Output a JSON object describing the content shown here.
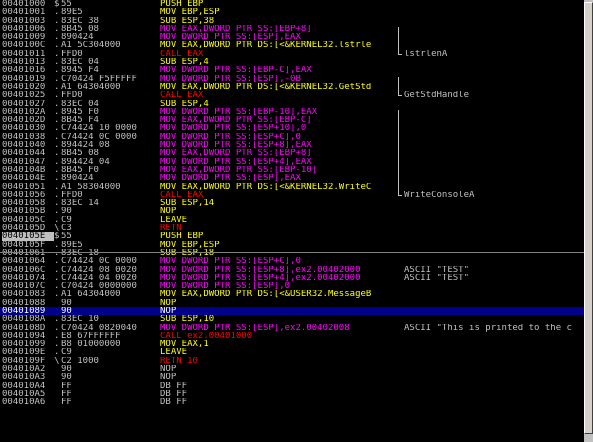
{
  "rows": [
    {
      "addr": "00401000",
      "mark": "$",
      "hex": "55",
      "dis": "PUSH EBP",
      "cls": "t-yellow",
      "cmt": ""
    },
    {
      "addr": "00401001",
      "mark": ".",
      "hex": "89E5",
      "dis": "MOV EBP,ESP",
      "cls": "t-yellow",
      "cmt": ""
    },
    {
      "addr": "00401003",
      "mark": ".",
      "hex": "83EC 38",
      "dis": "SUB ESP,38",
      "cls": "t-yellow",
      "cmt": ""
    },
    {
      "addr": "00401006",
      "mark": ".",
      "hex": "8B45 08",
      "dis": "MOV EAX,DWORD PTR SS:[EBP+8]",
      "cls": "t-purple",
      "cmt": ""
    },
    {
      "addr": "00401009",
      "mark": ".",
      "hex": "890424",
      "dis": "MOV DWORD PTR SS:[ESP],EAX",
      "cls": "t-purple",
      "cmt": ""
    },
    {
      "addr": "0040100C",
      "mark": ".",
      "hex": "A1 5C304000",
      "dis": "MOV EAX,DWORD PTR DS:[<&KERNEL32.lstrle",
      "cls": "t-yellow",
      "cmt": ""
    },
    {
      "addr": "00401011",
      "mark": ".",
      "hex": "FFD0",
      "dis": "CALL EAX",
      "cls": "t-red",
      "cmt": "lstrlenA"
    },
    {
      "addr": "00401013",
      "mark": ".",
      "hex": "83EC 04",
      "dis": "SUB ESP,4",
      "cls": "t-yellow",
      "cmt": ""
    },
    {
      "addr": "00401016",
      "mark": ".",
      "hex": "8945 F4",
      "dis": "MOV DWORD PTR SS:[EBP-C],EAX",
      "cls": "t-purple",
      "cmt": ""
    },
    {
      "addr": "00401019",
      "mark": ".",
      "hex": "C70424 F5FFFFF",
      "dis": "MOV DWORD PTR SS:[ESP],-0B",
      "cls": "t-purple",
      "cmt": ""
    },
    {
      "addr": "00401020",
      "mark": ".",
      "hex": "A1 64304000",
      "dis": "MOV EAX,DWORD PTR DS:[<&KERNEL32.GetStd",
      "cls": "t-yellow",
      "cmt": ""
    },
    {
      "addr": "00401025",
      "mark": ".",
      "hex": "FFD0",
      "dis": "CALL EAX",
      "cls": "t-red",
      "cmt": "GetStdHandle"
    },
    {
      "addr": "00401027",
      "mark": ".",
      "hex": "83EC 04",
      "dis": "SUB ESP,4",
      "cls": "t-yellow",
      "cmt": ""
    },
    {
      "addr": "0040102A",
      "mark": ".",
      "hex": "8945 F0",
      "dis": "MOV DWORD PTR SS:[EBP-10],EAX",
      "cls": "t-purple",
      "cmt": ""
    },
    {
      "addr": "0040102D",
      "mark": ".",
      "hex": "8B45 F4",
      "dis": "MOV EAX,DWORD PTR SS:[EBP-C]",
      "cls": "t-purple",
      "cmt": ""
    },
    {
      "addr": "00401030",
      "mark": ".",
      "hex": "C74424 10 0000",
      "dis": "MOV DWORD PTR SS:[ESP+10],0",
      "cls": "t-purple",
      "cmt": ""
    },
    {
      "addr": "00401038",
      "mark": ".",
      "hex": "C74424 0C 0000",
      "dis": "MOV DWORD PTR SS:[ESP+C],0",
      "cls": "t-purple",
      "cmt": ""
    },
    {
      "addr": "00401040",
      "mark": ".",
      "hex": "894424 08",
      "dis": "MOV DWORD PTR SS:[ESP+8],EAX",
      "cls": "t-purple",
      "cmt": ""
    },
    {
      "addr": "00401044",
      "mark": ".",
      "hex": "8B45 08",
      "dis": "MOV EAX,DWORD PTR SS:[EBP+8]",
      "cls": "t-purple",
      "cmt": ""
    },
    {
      "addr": "00401047",
      "mark": ".",
      "hex": "894424 04",
      "dis": "MOV DWORD PTR SS:[ESP+4],EAX",
      "cls": "t-purple",
      "cmt": ""
    },
    {
      "addr": "0040104B",
      "mark": ".",
      "hex": "8B45 F0",
      "dis": "MOV EAX,DWORD PTR SS:[EBP-10]",
      "cls": "t-purple",
      "cmt": ""
    },
    {
      "addr": "0040104E",
      "mark": ".",
      "hex": "890424",
      "dis": "MOV DWORD PTR SS:[ESP],EAX",
      "cls": "t-purple",
      "cmt": ""
    },
    {
      "addr": "00401051",
      "mark": ".",
      "hex": "A1 58304000",
      "dis": "MOV EAX,DWORD PTR DS:[<&KERNEL32.WriteC",
      "cls": "t-yellow",
      "cmt": ""
    },
    {
      "addr": "00401056",
      "mark": ".",
      "hex": "FFD0",
      "dis": "CALL EAX",
      "cls": "t-red",
      "cmt": "WriteConsoleA"
    },
    {
      "addr": "00401058",
      "mark": ".",
      "hex": "83EC 14",
      "dis": "SUB ESP,14",
      "cls": "t-yellow",
      "cmt": ""
    },
    {
      "addr": "0040105B",
      "mark": ".",
      "hex": "90",
      "dis": "NOP",
      "cls": "t-yellow",
      "cmt": ""
    },
    {
      "addr": "0040105C",
      "mark": ".",
      "hex": "C9",
      "dis": "LEAVE",
      "cls": "t-yellow",
      "cmt": ""
    },
    {
      "addr": "0040105D",
      "mark": "\\",
      "hex": "C3",
      "dis": "RETN",
      "cls": "t-red",
      "cmt": ""
    },
    {
      "addr": "0040105E",
      "mark": "$",
      "hex": "55",
      "dis": "PUSH EBP",
      "cls": "t-yellow",
      "cmt": "",
      "addrsel": true
    },
    {
      "addr": "0040105F",
      "mark": ".",
      "hex": "89E5",
      "dis": "MOV EBP,ESP",
      "cls": "t-yellow",
      "cmt": ""
    },
    {
      "addr": "00401061",
      "mark": ".",
      "hex": "83EC 18",
      "dis": "SUB ESP,18",
      "cls": "t-yellow",
      "cmt": ""
    },
    {
      "addr": "00401064",
      "mark": ".",
      "hex": "C74424 0C 0000",
      "dis": "MOV DWORD PTR SS:[ESP+C],0",
      "cls": "t-purple",
      "cmt": ""
    },
    {
      "addr": "0040106C",
      "mark": ".",
      "hex": "C74424 08 0020",
      "dis": "MOV DWORD PTR SS:[ESP+8],ex2.00402000",
      "cls": "t-purple",
      "cmt": "ASCII \"TEST\""
    },
    {
      "addr": "00401074",
      "mark": ".",
      "hex": "C74424 04 0020",
      "dis": "MOV DWORD PTR SS:[ESP+4],ex2.00402000",
      "cls": "t-purple",
      "cmt": "ASCII \"TEST\""
    },
    {
      "addr": "0040107C",
      "mark": ".",
      "hex": "C70424 0000000",
      "dis": "MOV DWORD PTR SS:[ESP],0",
      "cls": "t-purple",
      "cmt": ""
    },
    {
      "addr": "00401083",
      "mark": ".",
      "hex": "A1 64304000",
      "dis": "MOV EAX,DWORD PTR DS:[<&USER32.MessageB",
      "cls": "t-yellow",
      "cmt": ""
    },
    {
      "addr": "00401088",
      "mark": " ",
      "hex": "90",
      "dis": "NOP",
      "cls": "t-yellow",
      "cmt": ""
    },
    {
      "addr": "00401089",
      "mark": " ",
      "hex": "90",
      "dis": "NOP",
      "cls": "t-yellow",
      "cmt": "",
      "sel": true
    },
    {
      "addr": "0040108A",
      "mark": ".",
      "hex": "83EC 10",
      "dis": "SUB ESP,10",
      "cls": "t-yellow",
      "cmt": ""
    },
    {
      "addr": "0040108D",
      "mark": ".",
      "hex": "C70424 0820040",
      "dis": "MOV DWORD PTR SS:[ESP],ex2.00402008",
      "cls": "t-purple",
      "cmt": "ASCII \"This is printed to the c"
    },
    {
      "addr": "00401094",
      "mark": ".",
      "hex": "E8 67FFFFFF",
      "dis": "CALL ex2.00401000",
      "cls": "t-red",
      "cmt": ""
    },
    {
      "addr": "00401099",
      "mark": ".",
      "hex": "B8 01000000",
      "dis": "MOV EAX,1",
      "cls": "t-yellow",
      "cmt": ""
    },
    {
      "addr": "0040109E",
      "mark": ".",
      "hex": "C9",
      "dis": "LEAVE",
      "cls": "t-yellow",
      "cmt": ""
    },
    {
      "addr": "0040109F",
      "mark": "\\",
      "hex": "C2 1000",
      "dis": "RETN 10",
      "cls": "t-red",
      "cmt": ""
    },
    {
      "addr": "004010A2",
      "mark": " ",
      "hex": "90",
      "dis": "NOP",
      "cls": "t-norm",
      "cmt": ""
    },
    {
      "addr": "004010A3",
      "mark": " ",
      "hex": "90",
      "dis": "NOP",
      "cls": "t-norm",
      "cmt": ""
    },
    {
      "addr": "004010A4",
      "mark": " ",
      "hex": "FF",
      "dis": "DB FF",
      "cls": "t-norm",
      "cmt": ""
    },
    {
      "addr": "004010A5",
      "mark": " ",
      "hex": "FF",
      "dis": "DB FF",
      "cls": "t-norm",
      "cmt": ""
    },
    {
      "addr": "004010A6",
      "mark": " ",
      "hex": "FF",
      "dis": "DB FF",
      "cls": "t-norm",
      "cmt": ""
    }
  ],
  "colors": {
    "background": "#000000",
    "normal": "#c0c0c0",
    "mov": "#ff00ff",
    "arith": "#ffff00",
    "call": "#ff0000",
    "selection": "#00008b"
  }
}
